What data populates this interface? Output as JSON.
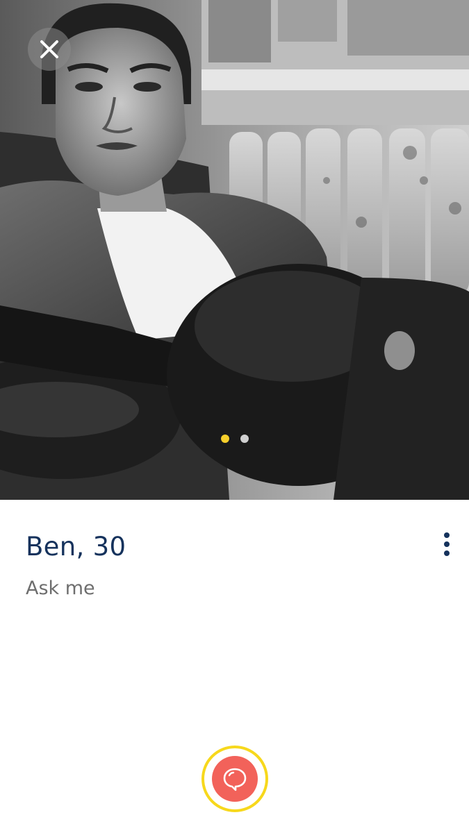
{
  "profile": {
    "name_age": "Ben, 30",
    "status": "Ask me"
  },
  "gallery": {
    "photo_count": 2,
    "active_index": 0,
    "photo_description_icon": "profile-photo"
  },
  "icons": {
    "close": "close-icon",
    "more": "more-vertical-icon",
    "chat": "chat-bubble-icon"
  },
  "colors": {
    "accent_yellow": "#f7cf2b",
    "chat_red": "#f2625a",
    "name_navy": "#15325c",
    "status_gray": "#6e6e6e"
  }
}
